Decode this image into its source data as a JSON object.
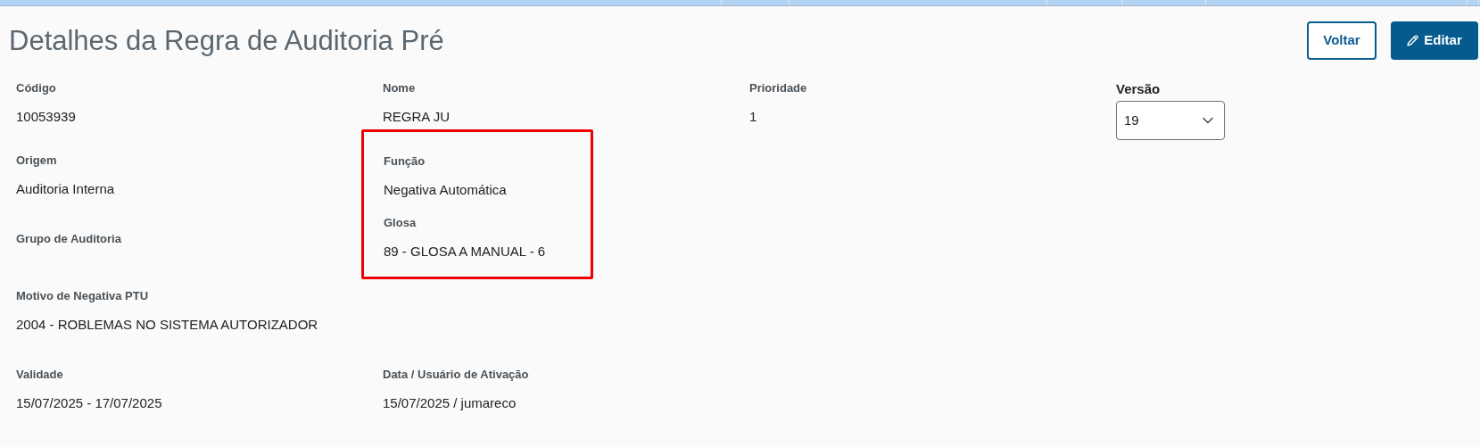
{
  "title": "Detalhes da Regra de Auditoria Pré",
  "buttons": [
    {
      "kind": "outline",
      "label": "Voltar"
    },
    {
      "kind": "primary",
      "label": "Editar"
    }
  ],
  "top_fields": [
    {
      "label": "Código",
      "value": "10053939"
    },
    {
      "label": "Nome",
      "value": "REGRA JU"
    },
    {
      "label": "Prioridade",
      "value": "1"
    }
  ],
  "version": {
    "label": "Versão",
    "value": "19"
  },
  "left_fields": [
    {
      "label": "Origem",
      "value": "Auditoria Interna"
    },
    {
      "label": "Grupo de Auditoria"
    },
    {
      "label": "Motivo de Negativa PTU",
      "value": "2004 - ROBLEMAS NO SISTEMA AUTORIZADOR"
    }
  ],
  "highlighted_group": {
    "highlighted": true,
    "fields": [
      {
        "label": "Função",
        "value": "Negativa Automática"
      },
      {
        "label": "Glosa",
        "value": "89 - GLOSA A MANUAL - 6"
      }
    ]
  },
  "bottom_fields": [
    {
      "label": "Validade",
      "value": "15/07/2025 - 17/07/2025"
    },
    {
      "label": "Data / Usuário de Ativação",
      "value": "15/07/2025 / jumareco"
    }
  ]
}
